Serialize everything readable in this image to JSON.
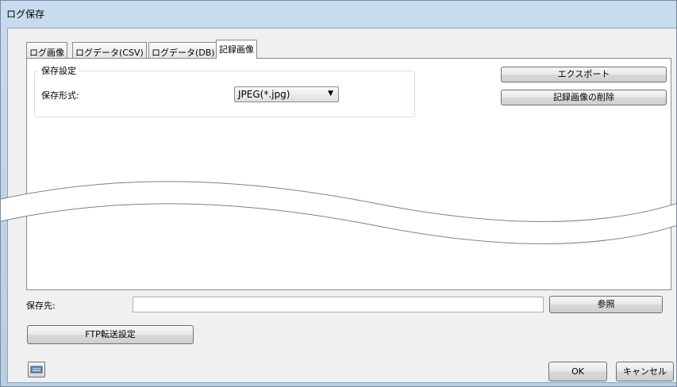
{
  "window": {
    "title": "ログ保存"
  },
  "tabs": [
    {
      "label": "ログ画像",
      "active": false
    },
    {
      "label": "ログデータ(CSV)",
      "active": false
    },
    {
      "label": "ログデータ(DB)",
      "active": false
    },
    {
      "label": "記録画像",
      "active": true
    }
  ],
  "save_settings": {
    "group_label": "保存設定",
    "format_label": "保存形式:",
    "format_value": "JPEG(*.jpg)"
  },
  "actions": {
    "export_label": "エクスポート",
    "delete_label": "記録画像の削除"
  },
  "destination": {
    "label": "保存先:",
    "value": "",
    "browse_label": "参照"
  },
  "ftp_button_label": "FTP転送設定",
  "footer": {
    "ok_label": "OK",
    "cancel_label": "キャンセル"
  },
  "colors": {
    "title_bar": "#b6cde6",
    "dialog_face": "#f0f0f0",
    "panel_background": "#ffffff",
    "button_border": "#707070"
  }
}
